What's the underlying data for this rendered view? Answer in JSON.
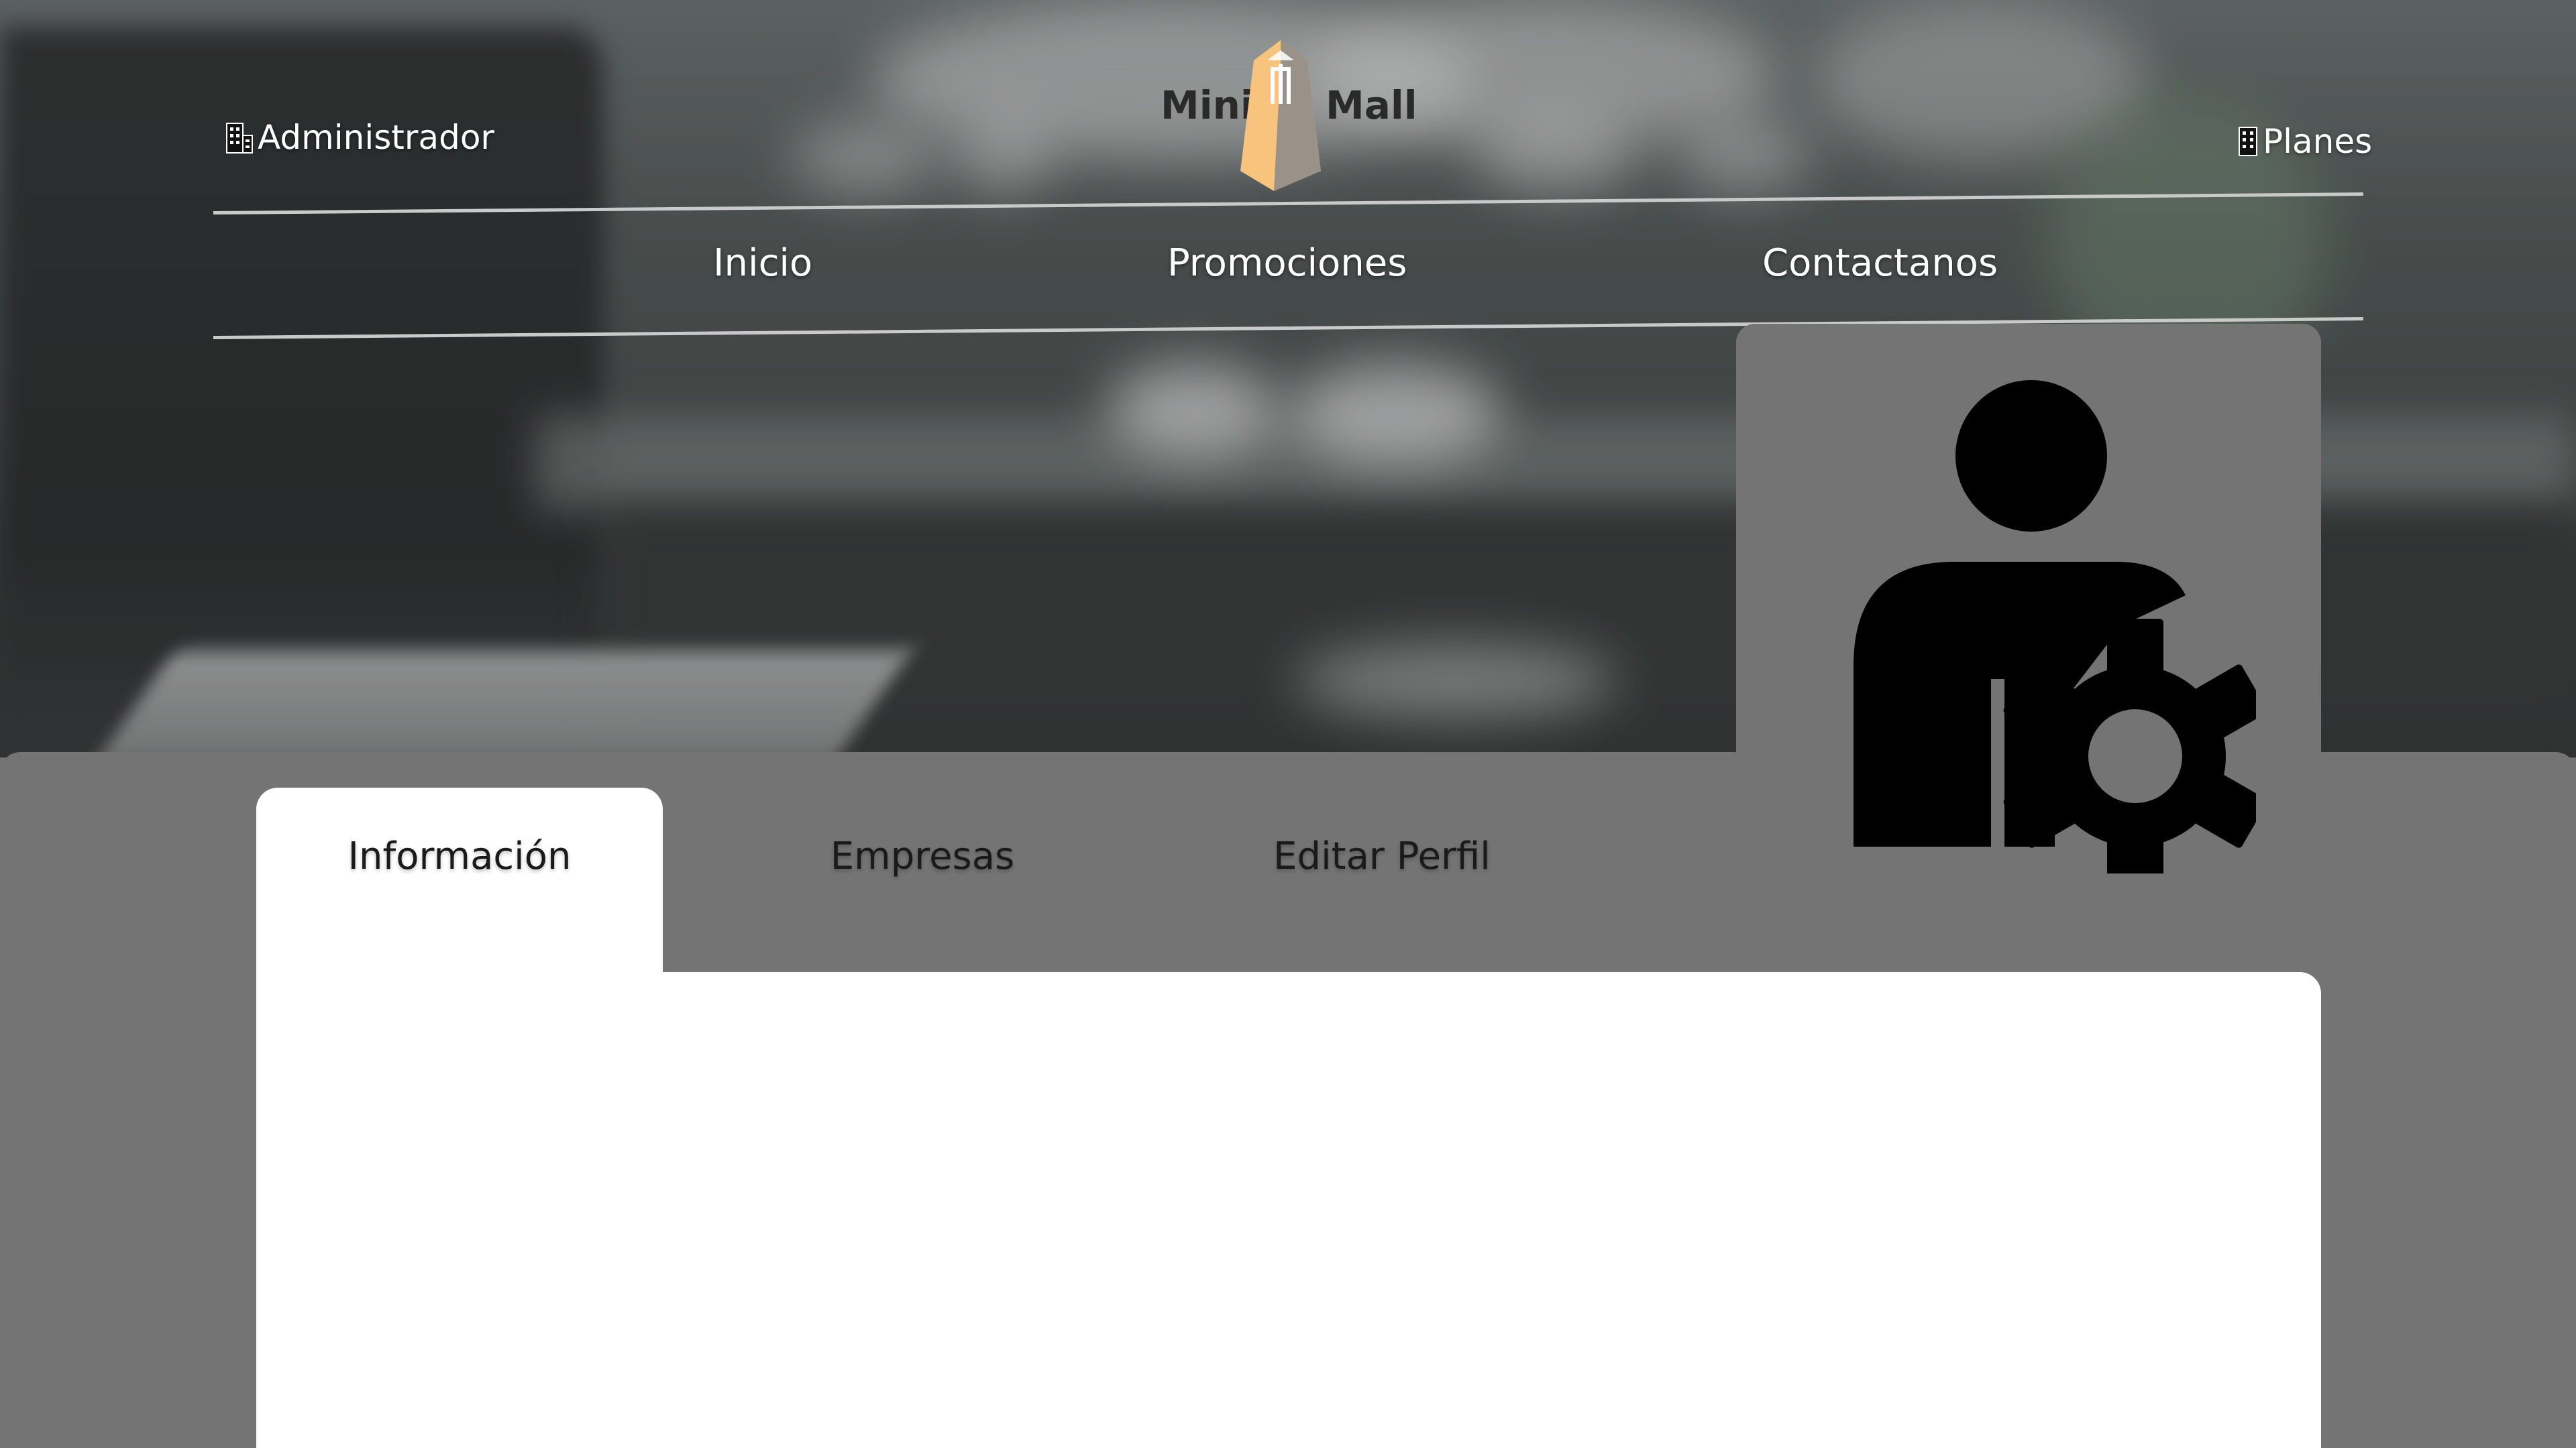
{
  "header": {
    "admin_label": "Administrador",
    "planes_label": "Planes",
    "logo": {
      "left_word": "Mini",
      "right_word": "Mall"
    }
  },
  "nav": {
    "items": [
      {
        "label": "Inicio"
      },
      {
        "label": "Promociones"
      },
      {
        "label": "Contactanos"
      }
    ]
  },
  "profile": {
    "tabs": [
      {
        "label": "Información",
        "active": true
      },
      {
        "label": "Empresas",
        "active": false
      },
      {
        "label": "Editar Perfil",
        "active": false
      }
    ],
    "avatar_icon": "user-gear-icon"
  },
  "colors": {
    "panel": "#747474",
    "logo_accent": "#f7c37d",
    "content": "#ffffff"
  }
}
